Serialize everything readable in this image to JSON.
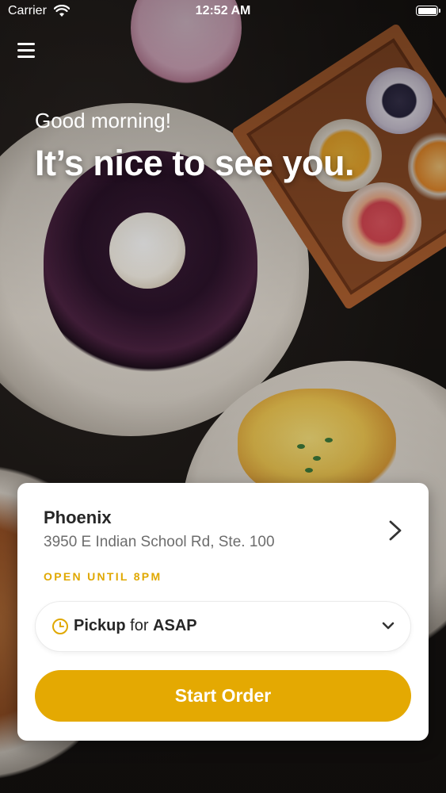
{
  "status_bar": {
    "carrier": "Carrier",
    "time": "12:52 AM",
    "icons": [
      "wifi-icon",
      "battery-icon"
    ]
  },
  "header": {
    "menu_icon": "hamburger-menu-icon",
    "greeting": "Good morning!",
    "headline": "It’s nice to see you."
  },
  "location_card": {
    "name": "Phoenix",
    "address": "3950 E Indian School Rd, Ste. 100",
    "hours": "OPEN UNTIL 8PM",
    "chevron_icon": "chevron-right-icon",
    "order_mode": {
      "icon": "clock-icon",
      "mode": "Pickup",
      "connector": "for",
      "time": "ASAP",
      "dropdown_icon": "chevron-down-icon"
    },
    "start_button": "Start Order"
  },
  "colors": {
    "accent": "#e4a902",
    "hours_text": "#e0a800",
    "card_bg": "#ffffff",
    "title_text": "#262626",
    "address_text": "#6d6d6d"
  }
}
